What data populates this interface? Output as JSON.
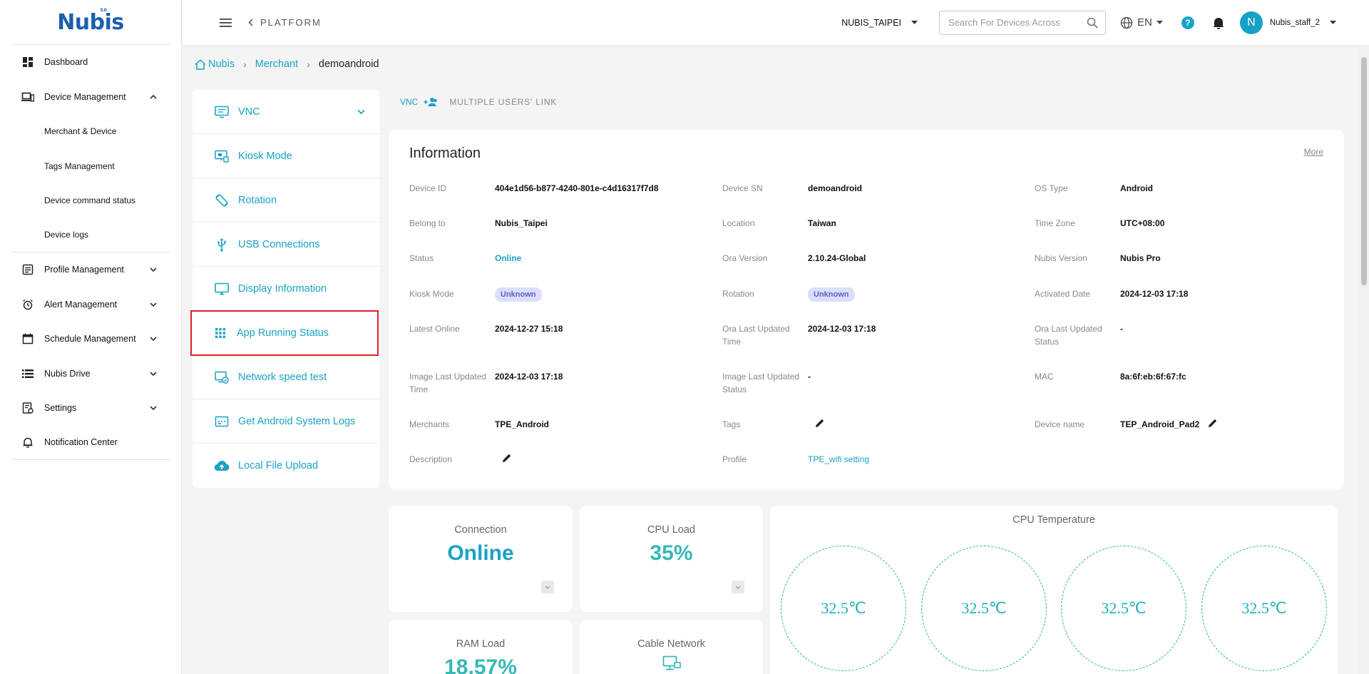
{
  "brand": {
    "logo": "Nubis",
    "logo_sup": "5.0"
  },
  "header": {
    "platform": "PLATFORM",
    "org": "NUBIS_TAIPEI",
    "search_placeholder": "Search For Devices Across",
    "lang": "EN",
    "help": "?",
    "avatar_initial": "N",
    "username": "Nubis_staff_2"
  },
  "sidebar": {
    "items": [
      {
        "label": "Dashboard",
        "icon": "dashboard-icon"
      },
      {
        "label": "Device Management",
        "icon": "devices-icon",
        "expanded": true,
        "children": [
          "Merchant & Device",
          "Tags Management",
          "Device command status",
          "Device logs"
        ]
      },
      {
        "label": "Profile Management",
        "icon": "profile-icon"
      },
      {
        "label": "Alert Management",
        "icon": "alarm-icon"
      },
      {
        "label": "Schedule Management",
        "icon": "calendar-icon"
      },
      {
        "label": "Nubis Drive",
        "icon": "drive-icon"
      },
      {
        "label": "Settings",
        "icon": "settings-icon"
      },
      {
        "label": "Notification Center",
        "icon": "bell-icon"
      }
    ]
  },
  "breadcrumb": {
    "home": "Nubis",
    "merchant": "Merchant",
    "current": "demoandroid"
  },
  "features": [
    {
      "label": "VNC",
      "icon": "vnc-icon"
    },
    {
      "label": "Kiosk Mode",
      "icon": "kiosk-icon"
    },
    {
      "label": "Rotation",
      "icon": "rotation-icon"
    },
    {
      "label": "USB Connections",
      "icon": "usb-icon"
    },
    {
      "label": "Display Information",
      "icon": "monitor-icon"
    },
    {
      "label": "App Running Status",
      "icon": "apps-grid-icon"
    },
    {
      "label": "Network speed test",
      "icon": "network-test-icon"
    },
    {
      "label": "Get Android System Logs",
      "icon": "logs-icon"
    },
    {
      "label": "Local File Upload",
      "icon": "cloud-upload-icon"
    }
  ],
  "vnc_links": {
    "vnc": "VNC",
    "multi": "MULTIPLE USERS' LINK"
  },
  "info": {
    "title": "Information",
    "more": "More",
    "device_id": {
      "label": "Device ID",
      "value": "404e1d56-b877-4240-801e-c4d16317f7d8"
    },
    "device_sn": {
      "label": "Device SN",
      "value": "demoandroid"
    },
    "os_type": {
      "label": "OS Type",
      "value": "Android"
    },
    "belong_to": {
      "label": "Belong to",
      "value": "Nubis_Taipei"
    },
    "location": {
      "label": "Location",
      "value": "Taiwan"
    },
    "time_zone": {
      "label": "Time Zone",
      "value": "UTC+08:00"
    },
    "status": {
      "label": "Status",
      "value": "Online"
    },
    "ora_version": {
      "label": "Ora Version",
      "value": "2.10.24-Global"
    },
    "nubis_version": {
      "label": "Nubis Version",
      "value": "Nubis Pro"
    },
    "kiosk_mode": {
      "label": "Kiosk Mode",
      "value": "Unknown"
    },
    "rotation": {
      "label": "Rotation",
      "value": "Unknown"
    },
    "activated_date": {
      "label": "Activated Date",
      "value": "2024-12-03 17:18"
    },
    "latest_online": {
      "label": "Latest Online",
      "value": "2024-12-27 15:18"
    },
    "ora_last_updated_time": {
      "label": "Ora Last Updated Time",
      "value": "2024-12-03 17:18"
    },
    "ora_last_updated_status": {
      "label": "Ora Last Updated Status",
      "value": "-"
    },
    "image_last_updated_time": {
      "label": "Image Last Updated Time",
      "value": "2024-12-03 17:18"
    },
    "image_last_updated_status": {
      "label": "Image Last Updated Status",
      "value": "-"
    },
    "mac": {
      "label": "MAC",
      "value": "8a:6f:eb:6f:67:fc"
    },
    "merchants": {
      "label": "Merchants",
      "value": "TPE_Android"
    },
    "tags": {
      "label": "Tags",
      "value": ""
    },
    "device_name": {
      "label": "Device name",
      "value": "TEP_Android_Pad2"
    },
    "description": {
      "label": "Description",
      "value": ""
    },
    "profile": {
      "label": "Profile",
      "value": "TPE_wifi setting"
    }
  },
  "stats": {
    "connection": {
      "title": "Connection",
      "value": "Online",
      "color": "#19a2c4"
    },
    "cpu_load": {
      "title": "CPU Load",
      "value": "35%",
      "color": "#36b8b5"
    },
    "ram_load": {
      "title": "RAM Load",
      "value": "18.57%",
      "color": "#36b8b5"
    },
    "cable_network": {
      "title": "Cable Network",
      "icon": "network-icon"
    },
    "cpu_temperature": {
      "title": "CPU Temperature",
      "values": [
        "32.5℃",
        "32.5℃",
        "32.5℃",
        "32.5℃"
      ]
    }
  }
}
